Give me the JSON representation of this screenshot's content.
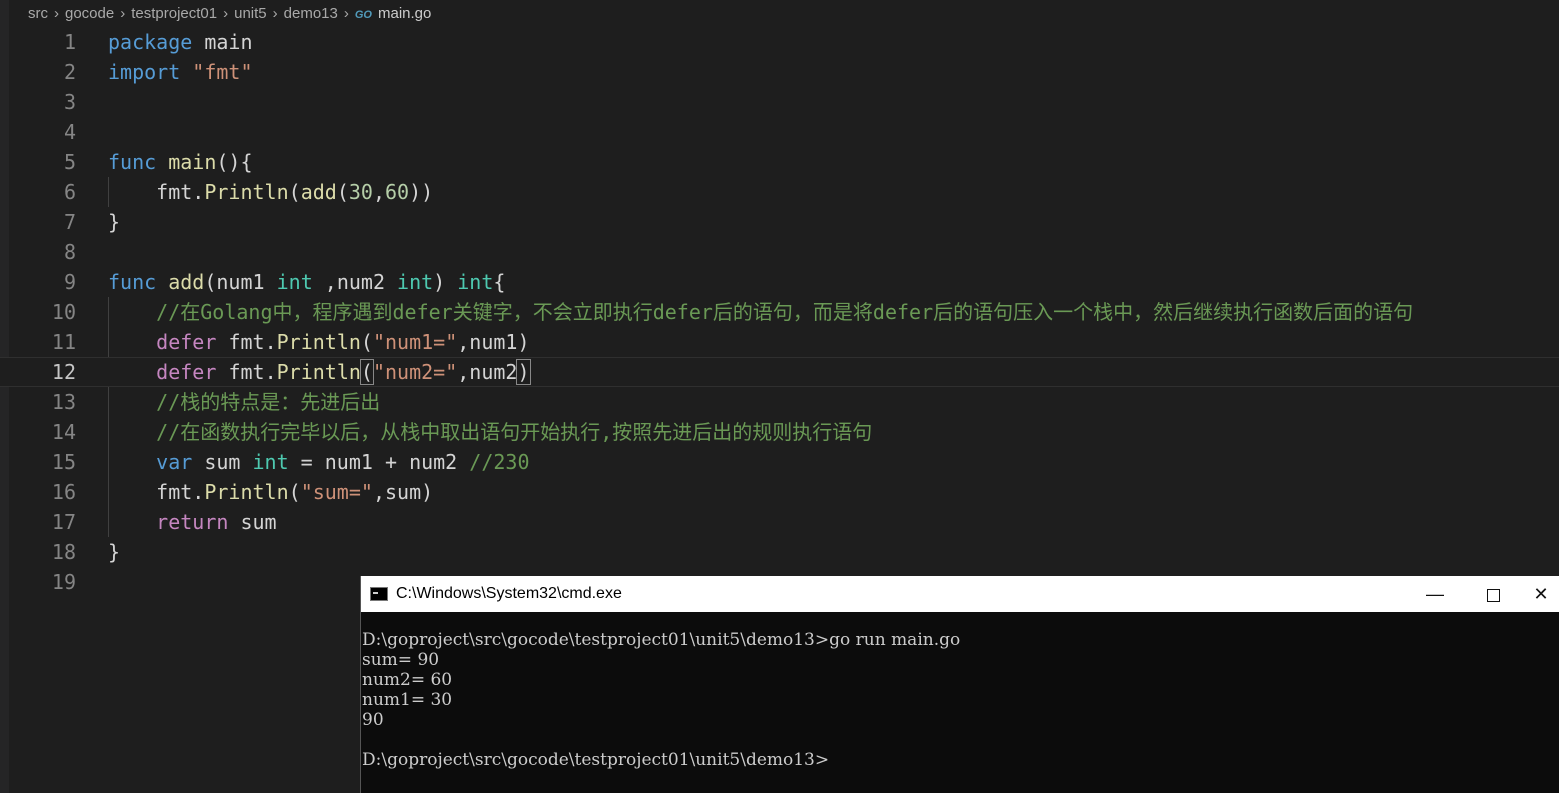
{
  "breadcrumb": {
    "parts": [
      "src",
      "gocode",
      "testproject01",
      "unit5",
      "demo13"
    ],
    "file_icon": "GO",
    "file": "main.go"
  },
  "editor": {
    "current_line": 12,
    "lines": [
      {
        "n": "1"
      },
      {
        "n": "2"
      },
      {
        "n": "3"
      },
      {
        "n": "4"
      },
      {
        "n": "5"
      },
      {
        "n": "6"
      },
      {
        "n": "7"
      },
      {
        "n": "8"
      },
      {
        "n": "9"
      },
      {
        "n": "10"
      },
      {
        "n": "11"
      },
      {
        "n": "12"
      },
      {
        "n": "13"
      },
      {
        "n": "14"
      },
      {
        "n": "15"
      },
      {
        "n": "16"
      },
      {
        "n": "17"
      },
      {
        "n": "18"
      },
      {
        "n": "19"
      }
    ],
    "tokens": {
      "l1": [
        "package",
        " main"
      ],
      "l2": [
        "import",
        " ",
        "\"fmt\""
      ],
      "l5": [
        "func",
        " ",
        "main",
        "(){"
      ],
      "l6": [
        "    ",
        "fmt",
        ".",
        "Println",
        "(",
        "add",
        "(",
        "30",
        ",",
        "60",
        "))"
      ],
      "l7": [
        "}"
      ],
      "l9": [
        "func",
        " ",
        "add",
        "(",
        "num1",
        " ",
        "int",
        " ,",
        "num2",
        " ",
        "int",
        ") ",
        "int",
        "{"
      ],
      "l10": [
        "    ",
        "//在Golang中，程序遇到defer关键字，不会立即执行defer后的语句，而是将defer后的语句压入一个栈中，然后继续执行函数后面的语句"
      ],
      "l11": [
        "    ",
        "defer",
        " ",
        "fmt",
        ".",
        "Println",
        "(",
        "\"num1=\"",
        ",",
        "num1",
        ")"
      ],
      "l12": [
        "    ",
        "defer",
        " ",
        "fmt",
        ".",
        "Println",
        "(",
        "\"num2=\"",
        ",",
        "num2",
        ")"
      ],
      "l13": [
        "    ",
        "//栈的特点是：先进后出"
      ],
      "l14": [
        "    ",
        "//在函数执行完毕以后，从栈中取出语句开始执行,按照先进后出的规则执行语句"
      ],
      "l15": [
        "    ",
        "var",
        " ",
        "sum",
        " ",
        "int",
        " = ",
        "num1",
        " + ",
        "num2",
        " ",
        "//230"
      ],
      "l16": [
        "    ",
        "fmt",
        ".",
        "Println",
        "(",
        "\"sum=\"",
        ",",
        "sum",
        ")"
      ],
      "l17": [
        "    ",
        "return",
        " ",
        "sum"
      ],
      "l18": [
        "}"
      ]
    }
  },
  "cmd": {
    "title": "C:\\Windows\\System32\\cmd.exe",
    "minimize": "—",
    "close": "✕",
    "output": "D:\\goproject\\src\\gocode\\testproject01\\unit5\\demo13>go run main.go\nsum= 90\nnum2= 60\nnum1= 30\n90\n\nD:\\goproject\\src\\gocode\\testproject01\\unit5\\demo13>"
  },
  "icons": {
    "cmd_icon": "console-icon",
    "maximize": "maximize-icon"
  }
}
